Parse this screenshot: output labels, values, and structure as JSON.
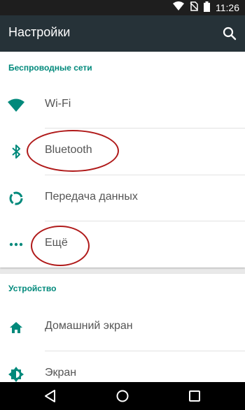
{
  "status_bar": {
    "time": "11:26"
  },
  "app_bar": {
    "title": "Настройки"
  },
  "sections": [
    {
      "header": "Беспроводные сети",
      "items": [
        {
          "label": "Wi-Fi",
          "icon": "wifi-icon"
        },
        {
          "label": "Bluetooth",
          "icon": "bluetooth-icon"
        },
        {
          "label": "Передача данных",
          "icon": "data-usage-icon"
        },
        {
          "label": "Ещё",
          "icon": "more-icon"
        }
      ]
    },
    {
      "header": "Устройство",
      "items": [
        {
          "label": "Домашний экран",
          "icon": "home-icon"
        },
        {
          "label": "Экран",
          "icon": "brightness-icon"
        }
      ]
    }
  ],
  "colors": {
    "accent": "#00897b",
    "appbar": "#263238",
    "annotation": "#b01a1a"
  }
}
